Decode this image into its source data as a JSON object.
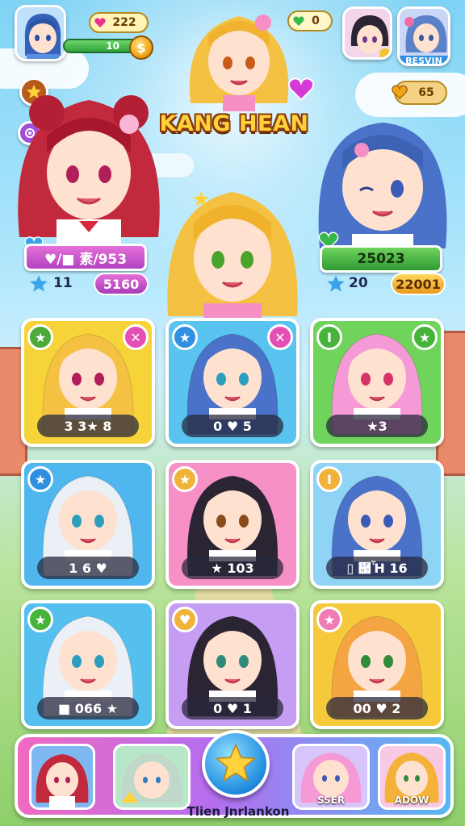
{
  "hud": {
    "hearts": "222",
    "gems": "0",
    "level_value": "10",
    "level_progress": 0.85,
    "coin_symbol": "$",
    "rank_badge": "BESVIN",
    "gold": "65"
  },
  "title": "KANG HEAN",
  "featured": {
    "left": {
      "name": "♥/■ 素/953",
      "stat_a": "11",
      "stat_b": "5160"
    },
    "right": {
      "name": "25023",
      "stat_a": "20",
      "stat_b": "22001"
    }
  },
  "cards": [
    {
      "score": "3 3★ 8",
      "bg": "#f7d33a",
      "left_badge": "★",
      "right_badge": "✕",
      "left_color": "#4caa3a",
      "right_color": "#e44fb6"
    },
    {
      "score": "0 ♥ 5",
      "bg": "#58c4ef",
      "left_badge": "★",
      "right_badge": "✕",
      "left_color": "#2f8fe0",
      "right_color": "#e44fb6"
    },
    {
      "score": "★3",
      "bg": "#6fd35c",
      "left_badge": "I",
      "right_badge": "★",
      "left_color": "#46b43a",
      "right_color": "#46b43a"
    },
    {
      "score": "1 6 ♥",
      "bg": "#4fb7ee",
      "left_badge": "★",
      "right_badge": "",
      "left_color": "#2f8fe0",
      "right_color": ""
    },
    {
      "score": "★ 103",
      "bg": "#f790c6",
      "left_badge": "★",
      "right_badge": "",
      "left_color": "#f1b23a",
      "right_color": ""
    },
    {
      "score": "▯ ὇Ἧ 16",
      "bg": "#8fd3f5",
      "left_badge": "I",
      "right_badge": "",
      "left_color": "#f1b23a",
      "right_color": ""
    },
    {
      "score": "■ 066 ★",
      "bg": "#55c0ee",
      "left_badge": "★",
      "right_badge": "",
      "left_color": "#46b43a",
      "right_color": ""
    },
    {
      "score": "0 ♥ 1",
      "bg": "#c59df2",
      "left_badge": "♥",
      "right_badge": "",
      "left_color": "#f1b23a",
      "right_color": ""
    },
    {
      "score": "00 ♥ 2",
      "bg": "#f5c93b",
      "left_badge": "★",
      "right_badge": "",
      "left_color": "#f07bb5",
      "right_color": ""
    }
  ],
  "dock": {
    "slot_c_label": "SSER",
    "slot_d_label": "ADOW",
    "caption": "Tlien Jnrlankon"
  },
  "colors": {
    "hair_red": "#c2293c",
    "hair_blonde": "#f5c142",
    "hair_blue": "#4a72c9",
    "hair_pink": "#f59ad6",
    "hair_black": "#2b2433",
    "hair_white": "#eaf0f6"
  },
  "icons": [
    "heart-icon",
    "gem-icon",
    "coin-icon",
    "star-icon",
    "close-icon",
    "gold-heart-icon"
  ]
}
